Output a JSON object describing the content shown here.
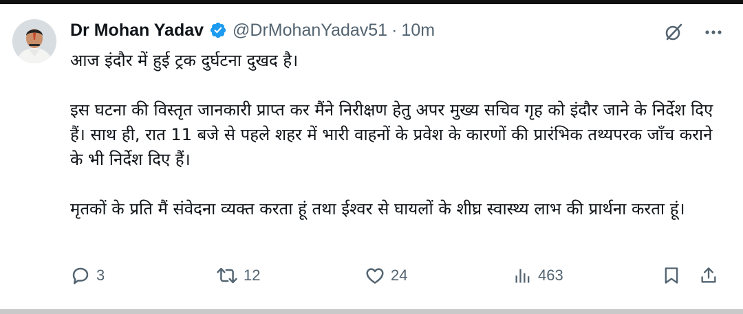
{
  "tweet": {
    "author_name": "Dr Mohan Yadav",
    "handle": "@DrMohanYadav51",
    "separator": "·",
    "time": "10m",
    "paragraphs": [
      "आज इंदौर में हुई ट्रक दुर्घटना दुखद है।",
      "इस घटना की विस्तृत जानकारी प्राप्त कर मैंने निरीक्षण हेतु अपर मुख्य सचिव गृह को इंदौर जाने के निर्देश दिए हैं। साथ ही, रात 11 बजे से पहले शहर में भारी वाहनों के प्रवेश के कारणों की प्रारंभिक तथ्यपरक जाँच कराने के भी निर्देश दिए हैं।",
      "मृतकों के प्रति मैं संवेदना व्यक्त करता हूं तथा ईश्वर से घायलों के शीघ्र स्वास्थ्य लाभ की प्रार्थना करता हूं।"
    ]
  },
  "actions": {
    "replies": "3",
    "reposts": "12",
    "likes": "24",
    "views": "463"
  },
  "icons": {
    "verified": "verified-badge-icon",
    "grok": "grok-icon",
    "more": "more-icon",
    "reply": "reply-icon",
    "repost": "repost-icon",
    "like": "like-icon",
    "views": "views-icon",
    "bookmark": "bookmark-icon",
    "share": "share-icon"
  },
  "colors": {
    "verified_blue": "#1d9bf0",
    "text_primary": "#0f1419",
    "text_secondary": "#536471"
  }
}
